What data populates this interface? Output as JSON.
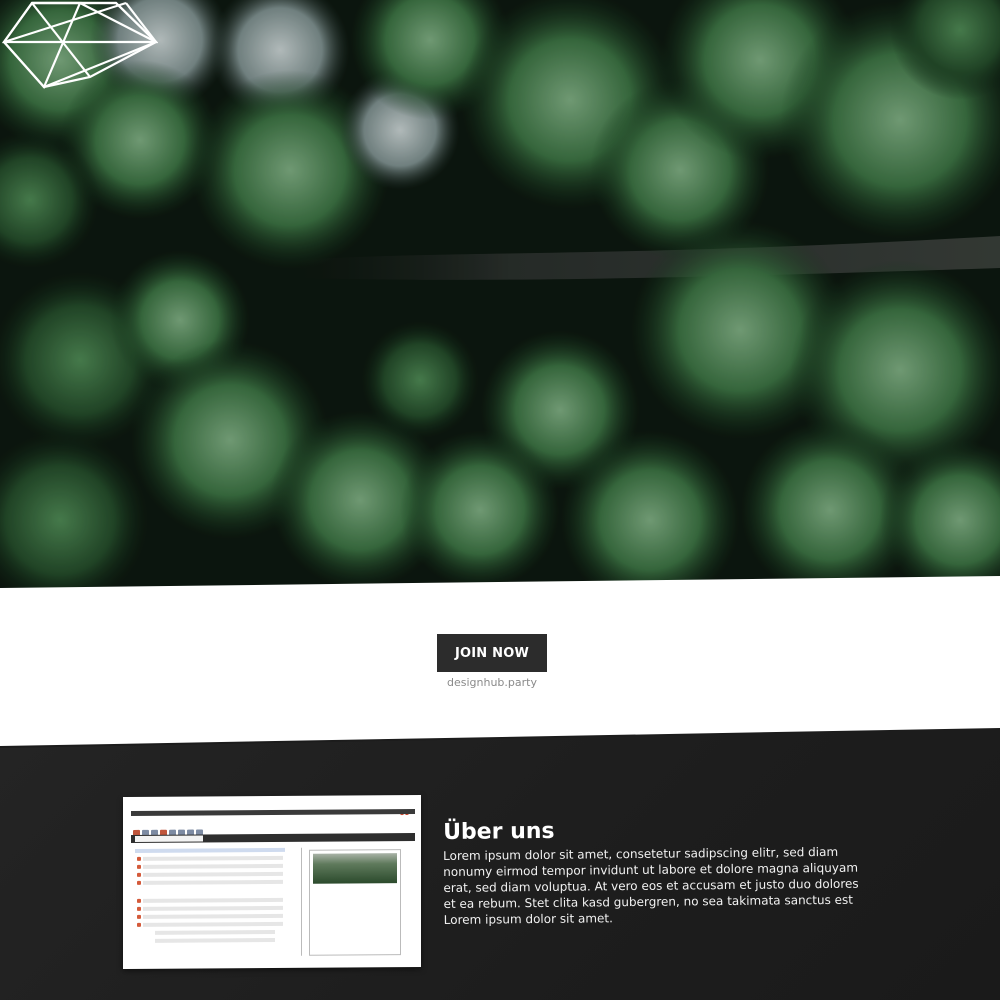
{
  "hero": {
    "logo_icon": "geometric-diamond-logo-icon",
    "background": "aerial-forest-road-photo"
  },
  "cta": {
    "button_label": "JOIN NOW",
    "subtitle": "designhub.party"
  },
  "about": {
    "title": "Über uns",
    "text": "Lorem ipsum dolor sit amet, consetetur sadipscing elitr, sed diam nonumy eirmod tempor invidunt ut labore et dolore magna aliquyam erat, sed diam voluptua. At vero eos et accusam et justo duo dolores et ea rebum. Stet clita kasd gubergren, no sea takimata sanctus est Lorem ipsum dolor sit amet.",
    "screenshot_icon": "app-screenshot-thumbnail"
  },
  "colors": {
    "button_bg": "#2c2c2c",
    "dark_section": "#1f1f1f",
    "accent_green": "#3f7a45"
  }
}
